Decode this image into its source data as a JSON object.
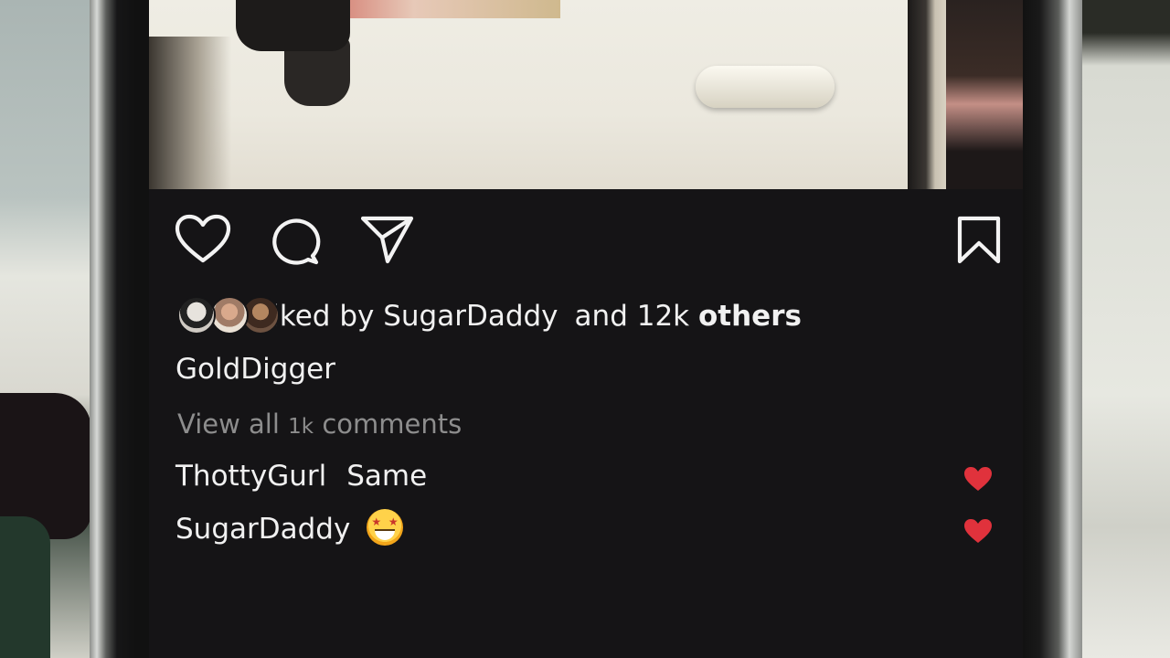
{
  "post": {
    "likes": {
      "prefix": "Liked by",
      "user": "SugarDaddy",
      "and": "and",
      "count": "12k",
      "suffix": "others"
    },
    "caption_user": "GoldDigger",
    "view_comments": {
      "prefix": "View all",
      "count": "1k",
      "suffix": "comments"
    },
    "comments": [
      {
        "user": "ThottyGurl",
        "text": "Same",
        "emoji": "",
        "liked": true
      },
      {
        "user": "SugarDaddy",
        "text": "",
        "emoji": "star-struck-emoji",
        "liked": true
      }
    ]
  },
  "icons": {
    "like": "heart-icon",
    "comment": "comment-icon",
    "share": "paper-plane-icon",
    "save": "bookmark-icon",
    "comment_like": "filled-heart-icon"
  },
  "colors": {
    "background": "#151416",
    "text": "#f1f1f1",
    "muted_text": "#8d8d8d",
    "heart_red": "#e0323c"
  }
}
